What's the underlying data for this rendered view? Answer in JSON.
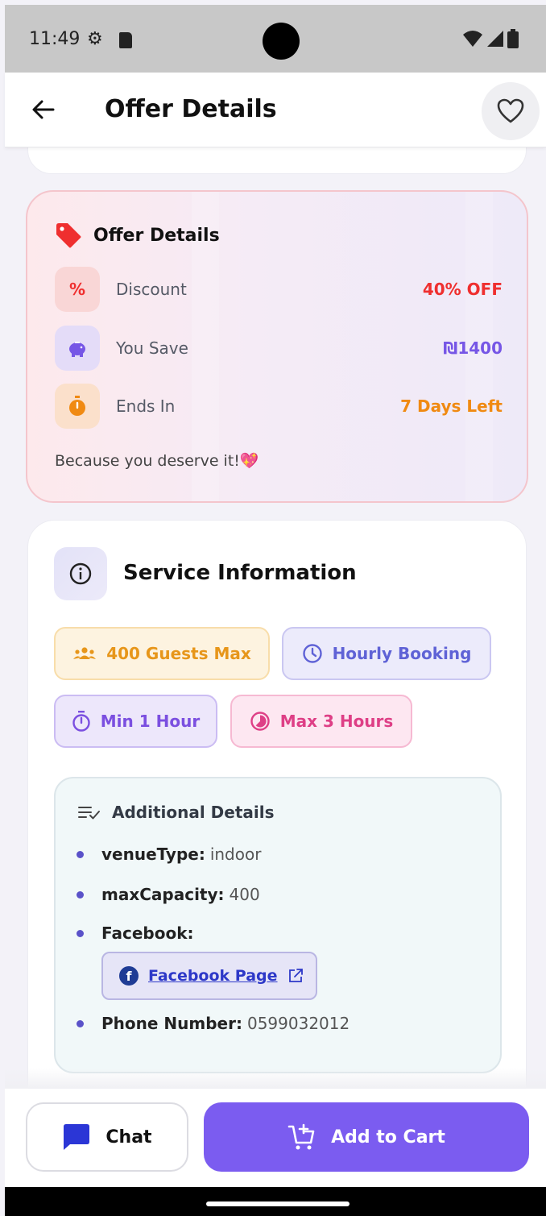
{
  "status_bar": {
    "time": "11:49"
  },
  "header": {
    "title": "Offer Details"
  },
  "offer": {
    "title": "Offer Details",
    "rows": [
      {
        "icon": "percent-icon",
        "label": "Discount",
        "value": "40% OFF",
        "color": "#ef2f2f"
      },
      {
        "icon": "piggy-bank-icon",
        "label": "You Save",
        "value": "₪1400",
        "color": "#7656e6"
      },
      {
        "icon": "stopwatch-icon",
        "label": "Ends In",
        "value": "7 Days Left",
        "color": "#f08a12"
      }
    ],
    "tagline": "Because you deserve it!💖"
  },
  "service": {
    "title": "Service Information",
    "chips": {
      "guests": "400 Guests Max",
      "hourly": "Hourly Booking",
      "min": "Min 1 Hour",
      "max": "Max 3 Hours"
    },
    "details": {
      "title": "Additional Details",
      "venue_key": "venueType:",
      "venue_val": "indoor",
      "capacity_key": "maxCapacity:",
      "capacity_val": "400",
      "facebook_key": "Facebook:",
      "facebook_link": "Facebook Page",
      "phone_key": "Phone Number:",
      "phone_val": "0599032012"
    }
  },
  "actions": {
    "chat": "Chat",
    "add_to_cart": "Add to Cart"
  },
  "colors": {
    "primary": "#7b5cf0",
    "discount": "#ef2f2f",
    "save": "#7656e6",
    "ends": "#f08a12"
  }
}
